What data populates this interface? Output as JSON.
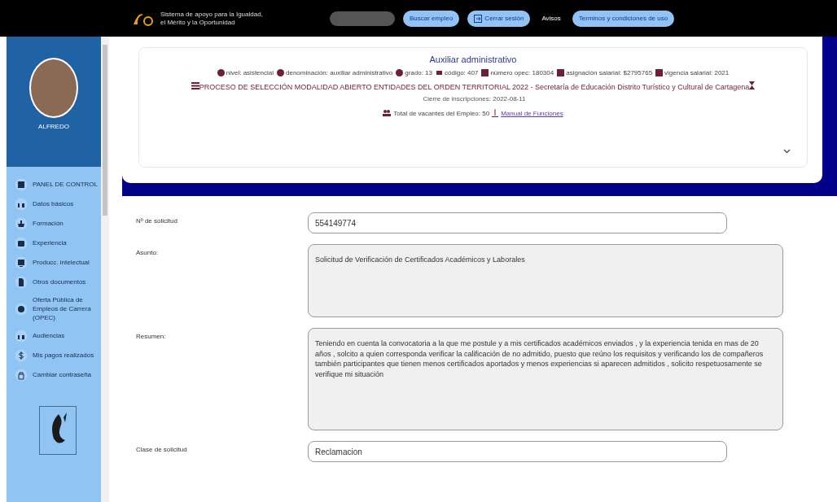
{
  "topbar": {
    "logo_text": "Sistema de apoyo para la Igualdad, el Mérito y la Oportunidad",
    "buttons": [
      {
        "label": "Buscar empleo",
        "kind": "pill"
      },
      {
        "label": "Cerrar sesión",
        "kind": "icon"
      },
      {
        "label": "Avisos",
        "kind": "plain"
      },
      {
        "label": "Terminos y condiciones de uso",
        "kind": "pill"
      }
    ]
  },
  "sidebar": {
    "user": "ALFREDO",
    "items": [
      {
        "label": "PANEL DE CONTROL"
      },
      {
        "label": "Datos básicos"
      },
      {
        "label": "Formación"
      },
      {
        "label": "Experiencia"
      },
      {
        "label": "Producc. intelectual"
      },
      {
        "label": "Otros documentos"
      },
      {
        "label": "Oferta Pública de Empleos de Carrera (OPEC)"
      },
      {
        "label": "Audiencias"
      },
      {
        "label": "Mis pagos realizados"
      },
      {
        "label": "Cambiar contraseña"
      }
    ]
  },
  "job": {
    "title": "Auxiliar administrativo",
    "attributes": [
      "nivel: asistencial",
      "denominación: auxiliar administrativo",
      "grado: 13",
      "código: 407",
      "número opec: 180304",
      "asignación salarial: $2795765",
      "vigencia salarial: 2021"
    ],
    "process": "PROCESO DE SELECCIÓN MODALIDAD ABIERTO ENTIDADES DEL ORDEN TERRITORIAL 2022 - Secretaría de Educación Distrito Turístico y Cultural de Cartagena",
    "closing": "Cierre de inscripciones: 2022-08-11",
    "vacancies": "Total de vacantes del Empleo: 50",
    "manual_link": "Manual de Funciones"
  },
  "form": [
    {
      "label": "Nº de solicitud",
      "value": "554149774",
      "kind": "input"
    },
    {
      "label": "Asunto:",
      "value": "Solicitud de Verificación de Certificados Académicos  y Laborales",
      "kind": "area-small"
    },
    {
      "label": "Resumen:",
      "value": "Teniendo en cuenta la convocatoria a la que me postule y a mis certificados académicos enviados , y la experiencia tenida en mas de 20 años , solcito a quien corresponda verificar la calificación de no admitido, puesto que reúno los requisitos y verificando los de compañeros también participantes  que tienen menos certificados aportados y menos experiencias si aparecen admitidos , solicito respetuosamente se verifique mi situación",
      "kind": "area-large"
    },
    {
      "label": "Clase de solicitud",
      "value": "Reclamacion",
      "kind": "input"
    }
  ]
}
